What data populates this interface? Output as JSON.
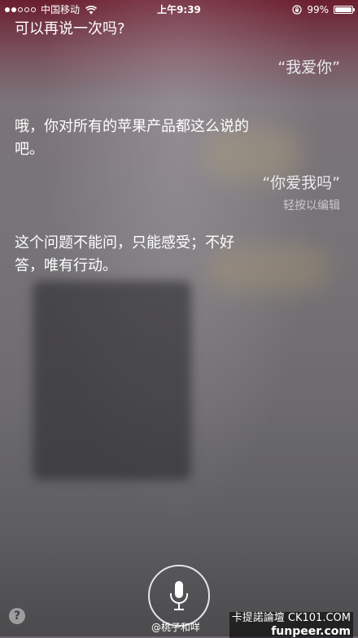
{
  "status_bar": {
    "signal_dots_filled": 2,
    "signal_dots_total": 5,
    "carrier": "中国移动",
    "time": "上午9:39",
    "battery_text": "99%",
    "battery_level": 0.99,
    "icons": [
      "wifi-icon",
      "orientation-lock-icon",
      "battery-icon"
    ]
  },
  "conversation": {
    "siri_prompt": "可以再说一次吗?",
    "user_query_1": "“我爱你”",
    "siri_reply_1": "哦，你对所有的苹果产品都这么说的吧。",
    "user_query_2": "“你爱我吗”",
    "tap_to_edit": "轻按以编辑",
    "siri_reply_2": "这个问题不能问，只能感受；不好答，唯有行动。"
  },
  "bottom": {
    "help_label": "?",
    "mic_icon": "microphone-icon",
    "watermark_user": "@桃子和咩",
    "brand_line1": "卡提諾論壇 CK101.COM",
    "brand_line2": "funpeer.com"
  },
  "colors": {
    "top_tint": "#6b1e2e",
    "background": "#767377",
    "text": "#ffffff"
  }
}
